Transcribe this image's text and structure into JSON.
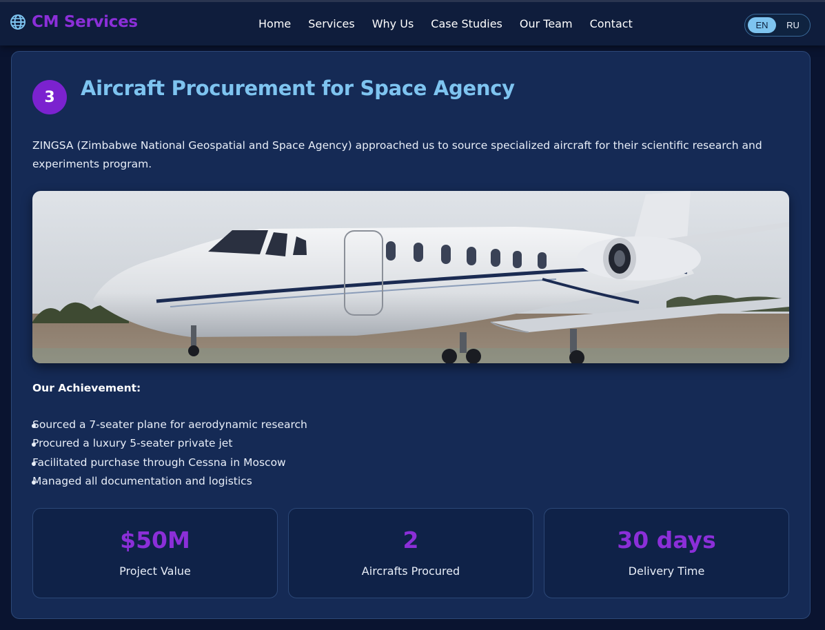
{
  "header": {
    "logo_text": "CM Services",
    "logo_icon": "globe-icon",
    "nav": [
      {
        "label": "Home"
      },
      {
        "label": "Services"
      },
      {
        "label": "Why Us"
      },
      {
        "label": "Case Studies"
      },
      {
        "label": "Our Team"
      },
      {
        "label": "Contact"
      }
    ],
    "languages": [
      {
        "label": "EN",
        "active": true
      },
      {
        "label": "RU",
        "active": false
      }
    ]
  },
  "case": {
    "number": "3",
    "title": "Aircraft Procurement for Space Agency",
    "description": "ZINGSA (Zimbabwe National Geospatial and Space Agency) approached us to source specialized aircraft for their scientific research and experiments program.",
    "image_subject": "white-business-jet-photo",
    "achievement_title": "Our Achievement:",
    "achievements": [
      "Sourced a 7-seater plane for aerodynamic research",
      "Procured a luxury 5-seater private jet",
      "Facilitated purchase through Cessna in Moscow",
      "Managed all documentation and logistics"
    ],
    "stats": [
      {
        "value": "$50M",
        "label": "Project Value"
      },
      {
        "value": "2",
        "label": "Aircrafts Procured"
      },
      {
        "value": "30 days",
        "label": "Delivery Time"
      }
    ]
  },
  "colors": {
    "accent_purple": "#8b2fd8",
    "title_blue": "#7ec4f0",
    "card_bg": "#152a55",
    "page_bg": "#0a1430"
  }
}
